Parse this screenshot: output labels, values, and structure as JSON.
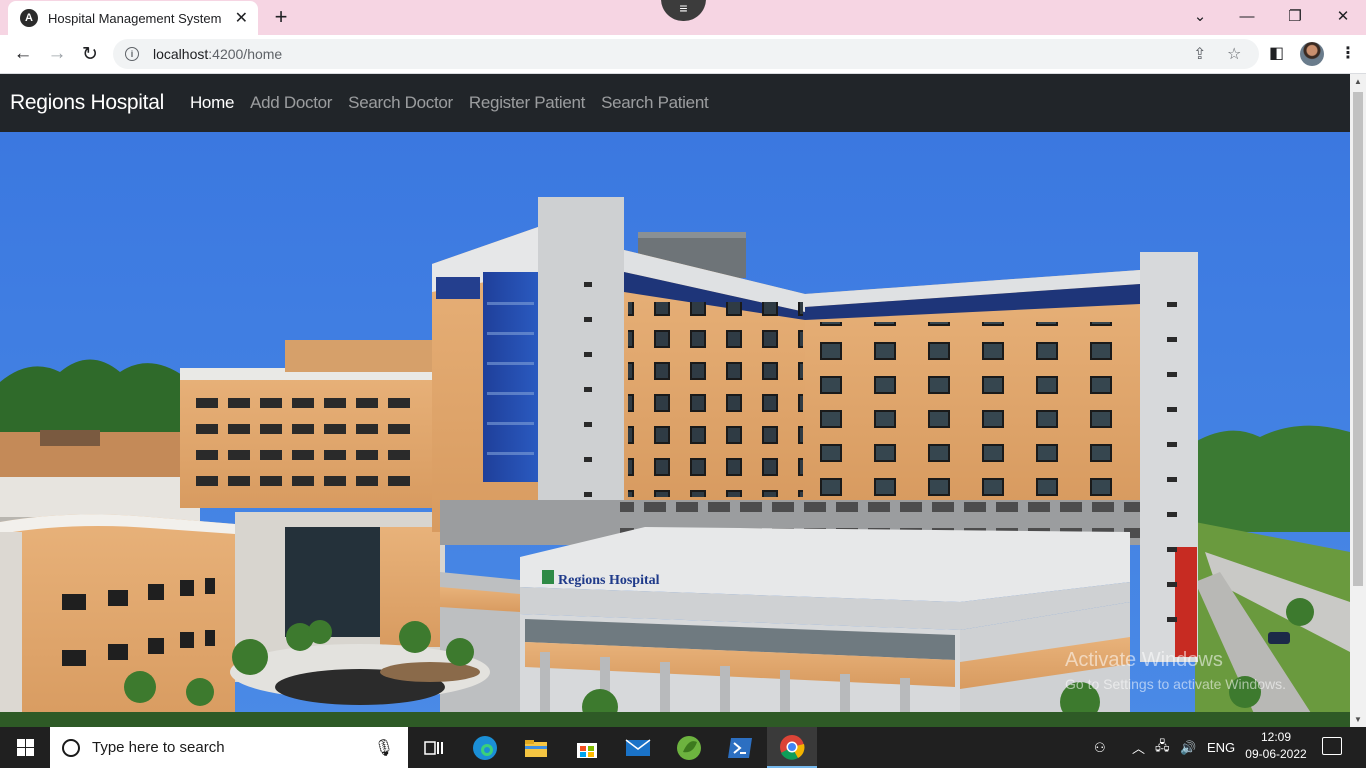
{
  "browser": {
    "tab_title": "Hospital Management System",
    "favicon_letter": "A",
    "url_host": "localhost",
    "url_path": ":4200/home",
    "window_controls": {
      "minimize": "—",
      "restore": "❐",
      "close": "✕",
      "tabsearch": "⌄"
    }
  },
  "navbar": {
    "brand": "Regions Hospital",
    "links": [
      {
        "label": "Home",
        "active": true
      },
      {
        "label": "Add Doctor",
        "active": false
      },
      {
        "label": "Search Doctor",
        "active": false
      },
      {
        "label": "Register Patient",
        "active": false
      },
      {
        "label": "Search Patient",
        "active": false
      }
    ]
  },
  "hero": {
    "building_sign": "Regions Hospital"
  },
  "watermark": {
    "line1": "Activate Windows",
    "line2": "Go to Settings to activate Windows."
  },
  "taskbar": {
    "search_placeholder": "Type here to search",
    "language": "ENG",
    "time": "12:09",
    "date": "09-06-2022"
  },
  "colors": {
    "navbar_bg": "#212529",
    "tabstrip_bg": "#f6d5e3",
    "taskbar_bg": "#202020",
    "sky": "#3d7be0"
  }
}
